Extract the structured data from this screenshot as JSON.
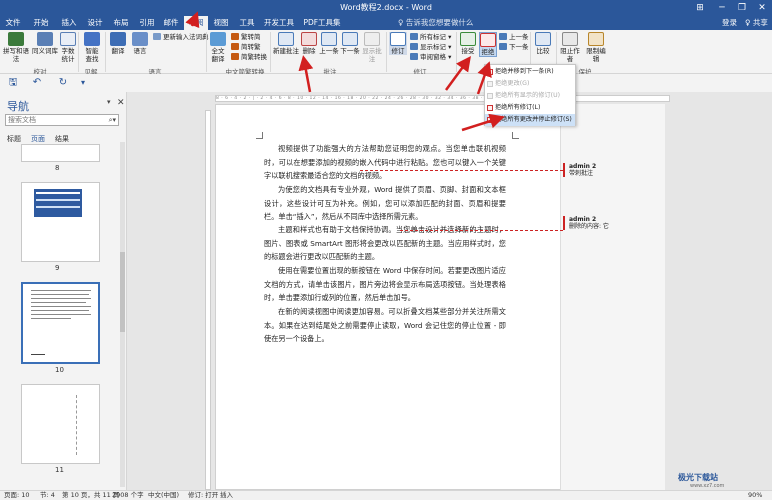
{
  "window": {
    "title": "Word教程2.docx - Word",
    "minimize": "─",
    "restore": "❐",
    "close": "✕",
    "help": "⊞"
  },
  "menu": {
    "tabs": [
      "文件",
      "开始",
      "插入",
      "设计",
      "布局",
      "引用",
      "邮件",
      "审阅",
      "视图",
      "工具",
      "开发工具",
      "PDF工具集"
    ],
    "active_tab": "审阅",
    "tell_me": "♀ 告诉我您想要做什么",
    "login": "登录",
    "share": "♀ 共享"
  },
  "ribbon": {
    "proofing": {
      "spelling": "拼写和语法",
      "thesaurus": "同义词库",
      "word_count": "字数\n统计",
      "title": "校对"
    },
    "insights": {
      "smart_lookup": "智能\n查找",
      "title": "见解"
    },
    "language": {
      "translate": "翻译",
      "language": "语言",
      "update_ime": "更新输入法词典",
      "title": "语言"
    },
    "chinese": {
      "full_width": "全文\n翻译",
      "to_simplified": "繁转简",
      "to_traditional": "简转繁",
      "convert": "简繁转换",
      "title": "中文简繁转换"
    },
    "comments": {
      "new": "新建批注",
      "delete": "删除",
      "previous": "上一条",
      "next": "下一条",
      "show": "显示批注",
      "title": "批注"
    },
    "tracking": {
      "track_changes": "修订",
      "all_markup": "所有标记",
      "show_markup": "显示标记",
      "reviewing_pane": "审阅窗格",
      "title": "修订"
    },
    "changes": {
      "accept": "接受",
      "reject": "拒绝",
      "previous": "上一条",
      "next": "下一条",
      "title": "更改"
    },
    "compare": {
      "compare": "比较",
      "title": "比较"
    },
    "protect": {
      "block_authors": "阻止作者",
      "restrict_editing": "限制编辑",
      "title": "保护"
    }
  },
  "reject_menu": {
    "items": [
      {
        "label": "拒绝并移到下一条(R)",
        "disabled": false
      },
      {
        "label": "拒绝更改(G)",
        "disabled": true
      },
      {
        "label": "拒绝所有显示的修订(U)",
        "disabled": true
      },
      {
        "label": "拒绝所有修订(L)",
        "disabled": false
      },
      {
        "label": "拒绝所有更改并停止修订(S)",
        "disabled": false,
        "highlighted": true
      }
    ]
  },
  "quick_access": {
    "save": "🖫",
    "undo": "↶",
    "redo": "↻",
    "customize": "▾"
  },
  "nav_pane": {
    "title": "导航",
    "search_placeholder": "搜索文档",
    "tabs": [
      "标题",
      "页面",
      "结果"
    ],
    "active_tab": "页面",
    "pages": [
      "8",
      "9",
      "10",
      "11"
    ],
    "selected_page": "10"
  },
  "document": {
    "ruler_text": "8 · 6 · 4 · 2 · | · 2 · 4 · 6 · 8 · 10 · 12 · 14 · 16 · 18 · 20 · 22 · 24 · 26 · 28 · 30 · 32 · 34 · 36 · 38 · 40 · 42 · 44 · 46 · 48",
    "paragraphs": [
      "视频提供了功能强大的方法帮助您证明您的观点。当您单击联机视频时，可以在想要添加的视频的嵌入代码中进行粘贴。您也可以键入一个关键字以联机搜索最适合您的文档的视频。",
      "为使您的文档具有专业外观，Word 提供了页眉、页脚、封面和文本框设计，这些设计可互为补充。例如，您可以添加匹配的封面、页眉和提要栏。单击“插入”，然后从不同库中选择所需元素。",
      "主题和样式也有助于文档保持协调。当您单击设计并选择新的主题时，图片、图表或 SmartArt 图形将会更改以匹配新的主题。当应用样式时，您的标题会进行更改以匹配新的主题。",
      "使用在需要位置出现的新按钮在 Word 中保存时间。若要更改图片适应文档的方式，请单击该图片，图片旁边将会显示布局选项按钮。当处理表格时，单击要添加行或列的位置，然后单击加号。",
      "在新的阅读视图中阅读更加容易。可以折叠文档某些部分并关注所需文本。如果在达到结尾处之前需要停止读取，Word 会记住您的停止位置 - 即使在另一个设备上。"
    ],
    "comments": [
      {
        "author": "admin 2",
        "text": "带刺批注"
      },
      {
        "author": "admin 2",
        "text": "删除的内容: 它"
      }
    ]
  },
  "status_bar": {
    "page": "页面: 10",
    "section": "节: 4",
    "page_of": "第 10 页，共 11 页",
    "words": "2908 个字",
    "language": "中文(中国)",
    "track": "修订: 打开",
    "mode": "插入",
    "zoom": "90%"
  },
  "watermark": {
    "text": "极光下载站",
    "url": "www.xz7.com"
  }
}
